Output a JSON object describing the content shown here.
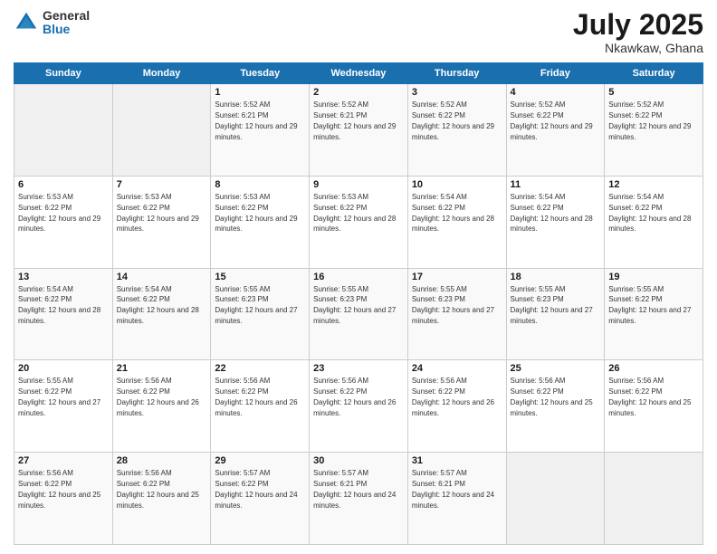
{
  "logo": {
    "general": "General",
    "blue": "Blue"
  },
  "title": {
    "month_year": "July 2025",
    "location": "Nkawkaw, Ghana"
  },
  "weekdays": [
    "Sunday",
    "Monday",
    "Tuesday",
    "Wednesday",
    "Thursday",
    "Friday",
    "Saturday"
  ],
  "weeks": [
    [
      {
        "day": "",
        "sunrise": "",
        "sunset": "",
        "daylight": ""
      },
      {
        "day": "",
        "sunrise": "",
        "sunset": "",
        "daylight": ""
      },
      {
        "day": "1",
        "sunrise": "Sunrise: 5:52 AM",
        "sunset": "Sunset: 6:21 PM",
        "daylight": "Daylight: 12 hours and 29 minutes."
      },
      {
        "day": "2",
        "sunrise": "Sunrise: 5:52 AM",
        "sunset": "Sunset: 6:21 PM",
        "daylight": "Daylight: 12 hours and 29 minutes."
      },
      {
        "day": "3",
        "sunrise": "Sunrise: 5:52 AM",
        "sunset": "Sunset: 6:22 PM",
        "daylight": "Daylight: 12 hours and 29 minutes."
      },
      {
        "day": "4",
        "sunrise": "Sunrise: 5:52 AM",
        "sunset": "Sunset: 6:22 PM",
        "daylight": "Daylight: 12 hours and 29 minutes."
      },
      {
        "day": "5",
        "sunrise": "Sunrise: 5:52 AM",
        "sunset": "Sunset: 6:22 PM",
        "daylight": "Daylight: 12 hours and 29 minutes."
      }
    ],
    [
      {
        "day": "6",
        "sunrise": "Sunrise: 5:53 AM",
        "sunset": "Sunset: 6:22 PM",
        "daylight": "Daylight: 12 hours and 29 minutes."
      },
      {
        "day": "7",
        "sunrise": "Sunrise: 5:53 AM",
        "sunset": "Sunset: 6:22 PM",
        "daylight": "Daylight: 12 hours and 29 minutes."
      },
      {
        "day": "8",
        "sunrise": "Sunrise: 5:53 AM",
        "sunset": "Sunset: 6:22 PM",
        "daylight": "Daylight: 12 hours and 29 minutes."
      },
      {
        "day": "9",
        "sunrise": "Sunrise: 5:53 AM",
        "sunset": "Sunset: 6:22 PM",
        "daylight": "Daylight: 12 hours and 28 minutes."
      },
      {
        "day": "10",
        "sunrise": "Sunrise: 5:54 AM",
        "sunset": "Sunset: 6:22 PM",
        "daylight": "Daylight: 12 hours and 28 minutes."
      },
      {
        "day": "11",
        "sunrise": "Sunrise: 5:54 AM",
        "sunset": "Sunset: 6:22 PM",
        "daylight": "Daylight: 12 hours and 28 minutes."
      },
      {
        "day": "12",
        "sunrise": "Sunrise: 5:54 AM",
        "sunset": "Sunset: 6:22 PM",
        "daylight": "Daylight: 12 hours and 28 minutes."
      }
    ],
    [
      {
        "day": "13",
        "sunrise": "Sunrise: 5:54 AM",
        "sunset": "Sunset: 6:22 PM",
        "daylight": "Daylight: 12 hours and 28 minutes."
      },
      {
        "day": "14",
        "sunrise": "Sunrise: 5:54 AM",
        "sunset": "Sunset: 6:22 PM",
        "daylight": "Daylight: 12 hours and 28 minutes."
      },
      {
        "day": "15",
        "sunrise": "Sunrise: 5:55 AM",
        "sunset": "Sunset: 6:23 PM",
        "daylight": "Daylight: 12 hours and 27 minutes."
      },
      {
        "day": "16",
        "sunrise": "Sunrise: 5:55 AM",
        "sunset": "Sunset: 6:23 PM",
        "daylight": "Daylight: 12 hours and 27 minutes."
      },
      {
        "day": "17",
        "sunrise": "Sunrise: 5:55 AM",
        "sunset": "Sunset: 6:23 PM",
        "daylight": "Daylight: 12 hours and 27 minutes."
      },
      {
        "day": "18",
        "sunrise": "Sunrise: 5:55 AM",
        "sunset": "Sunset: 6:23 PM",
        "daylight": "Daylight: 12 hours and 27 minutes."
      },
      {
        "day": "19",
        "sunrise": "Sunrise: 5:55 AM",
        "sunset": "Sunset: 6:22 PM",
        "daylight": "Daylight: 12 hours and 27 minutes."
      }
    ],
    [
      {
        "day": "20",
        "sunrise": "Sunrise: 5:55 AM",
        "sunset": "Sunset: 6:22 PM",
        "daylight": "Daylight: 12 hours and 27 minutes."
      },
      {
        "day": "21",
        "sunrise": "Sunrise: 5:56 AM",
        "sunset": "Sunset: 6:22 PM",
        "daylight": "Daylight: 12 hours and 26 minutes."
      },
      {
        "day": "22",
        "sunrise": "Sunrise: 5:56 AM",
        "sunset": "Sunset: 6:22 PM",
        "daylight": "Daylight: 12 hours and 26 minutes."
      },
      {
        "day": "23",
        "sunrise": "Sunrise: 5:56 AM",
        "sunset": "Sunset: 6:22 PM",
        "daylight": "Daylight: 12 hours and 26 minutes."
      },
      {
        "day": "24",
        "sunrise": "Sunrise: 5:56 AM",
        "sunset": "Sunset: 6:22 PM",
        "daylight": "Daylight: 12 hours and 26 minutes."
      },
      {
        "day": "25",
        "sunrise": "Sunrise: 5:56 AM",
        "sunset": "Sunset: 6:22 PM",
        "daylight": "Daylight: 12 hours and 25 minutes."
      },
      {
        "day": "26",
        "sunrise": "Sunrise: 5:56 AM",
        "sunset": "Sunset: 6:22 PM",
        "daylight": "Daylight: 12 hours and 25 minutes."
      }
    ],
    [
      {
        "day": "27",
        "sunrise": "Sunrise: 5:56 AM",
        "sunset": "Sunset: 6:22 PM",
        "daylight": "Daylight: 12 hours and 25 minutes."
      },
      {
        "day": "28",
        "sunrise": "Sunrise: 5:56 AM",
        "sunset": "Sunset: 6:22 PM",
        "daylight": "Daylight: 12 hours and 25 minutes."
      },
      {
        "day": "29",
        "sunrise": "Sunrise: 5:57 AM",
        "sunset": "Sunset: 6:22 PM",
        "daylight": "Daylight: 12 hours and 24 minutes."
      },
      {
        "day": "30",
        "sunrise": "Sunrise: 5:57 AM",
        "sunset": "Sunset: 6:21 PM",
        "daylight": "Daylight: 12 hours and 24 minutes."
      },
      {
        "day": "31",
        "sunrise": "Sunrise: 5:57 AM",
        "sunset": "Sunset: 6:21 PM",
        "daylight": "Daylight: 12 hours and 24 minutes."
      },
      {
        "day": "",
        "sunrise": "",
        "sunset": "",
        "daylight": ""
      },
      {
        "day": "",
        "sunrise": "",
        "sunset": "",
        "daylight": ""
      }
    ]
  ]
}
